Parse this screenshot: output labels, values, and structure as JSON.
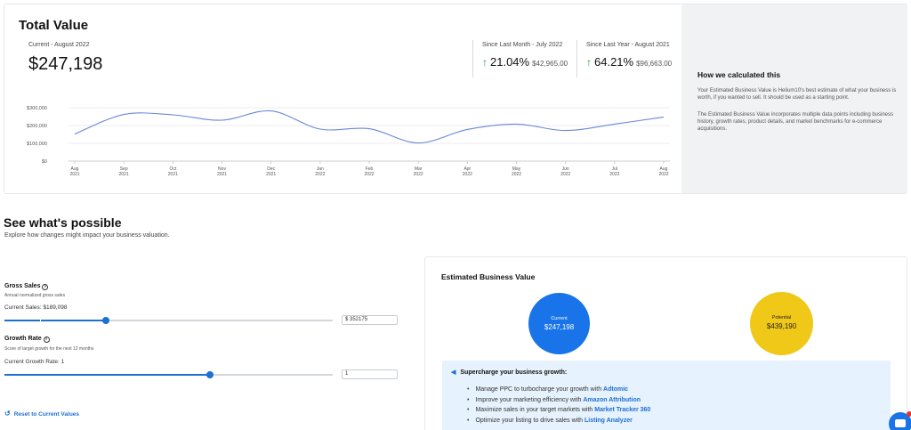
{
  "total_value": {
    "title": "Total Value",
    "current_label": "Current - August 2022",
    "current_value": "$247,198",
    "since_month": {
      "label": "Since Last Month - July 2022",
      "pct": "21.04%",
      "abs": "$42,965.00"
    },
    "since_year": {
      "label": "Since Last Year - August 2021",
      "pct": "64.21%",
      "abs": "$96,663.00"
    },
    "arrow_icon": "arrow-up-icon",
    "up_color": "#1aa34a"
  },
  "how_calculated": {
    "title": "How we calculated this",
    "p1": "Your Estimated Business Value is Helium10's best estimate of what your business is worth, if you wanted to sell. It should be used as a starting point.",
    "p2": "The Estimated Business Value incorporates multiple data points including business history, growth rates, product details, and market benchmarks for e-commerce acquisitions."
  },
  "chart_data": {
    "type": "line",
    "categories": [
      "Aug 2021",
      "Sep 2021",
      "Oct 2021",
      "Nov 2021",
      "Dec 2021",
      "Jan 2022",
      "Feb 2022",
      "Mar 2022",
      "Apr 2022",
      "May 2022",
      "Jun 2022",
      "Jul 2022",
      "Aug 2022"
    ],
    "x_tick_lines": [
      [
        "Aug",
        "2021"
      ],
      [
        "Sep",
        "2021"
      ],
      [
        "Oct",
        "2021"
      ],
      [
        "Nov",
        "2021"
      ],
      [
        "Dec",
        "2021"
      ],
      [
        "Jan",
        "2022"
      ],
      [
        "Feb",
        "2022"
      ],
      [
        "Mar",
        "2022"
      ],
      [
        "Apr",
        "2022"
      ],
      [
        "May",
        "2022"
      ],
      [
        "Jun",
        "2022"
      ],
      [
        "Jul",
        "2022"
      ],
      [
        "Aug",
        "2022"
      ]
    ],
    "series": [
      {
        "values": [
          152000,
          262000,
          260000,
          230000,
          282000,
          180000,
          182000,
          102000,
          178000,
          208000,
          172000,
          208000,
          248000
        ]
      }
    ],
    "y_ticks": [
      0,
      100000,
      200000,
      300000
    ],
    "y_tick_labels": [
      "$0",
      "$100,000",
      "$200,000",
      "$300,000"
    ],
    "ylim": [
      0,
      300000
    ],
    "grid": true,
    "line_color": "#6a86d8"
  },
  "possible": {
    "title": "See what's possible",
    "subtitle": "Explore how changes might impact your business valuation."
  },
  "gross_sales": {
    "label": "Gross Sales",
    "info_icon": "info-icon",
    "description": "Annual normalized gross sales",
    "current": "Current Sales: $189,098",
    "input_value": "$  352175",
    "slider_fraction": 0.31
  },
  "growth_rate": {
    "label": "Growth Rate",
    "info_icon": "info-icon",
    "description": "Score of target growth for the next 12 months",
    "current": "Current Growth Rate: 1",
    "input_value": "1",
    "slider_fraction": 0.625
  },
  "reset_label": "Reset to Current Values",
  "ebv": {
    "title": "Estimated Business Value",
    "current_label": "Current",
    "current_value": "$247,198",
    "potential_label": "Potential",
    "potential_value": "$439,190",
    "current_color": "#1874e8",
    "potential_color": "#f0c818"
  },
  "growth": {
    "title": "Supercharge your business growth:",
    "icon": "megaphone-icon",
    "items": [
      {
        "text": "Manage PPC to turbocharge your growth with ",
        "link": "Adtomic"
      },
      {
        "text": "Improve your marketing efficiency with ",
        "link": "Amazon Attribution"
      },
      {
        "text": "Maximize sales in your target markets with ",
        "link": "Market Tracker 360"
      },
      {
        "text": "Optimize your listing to drive sales with ",
        "link": "Listing Analyzer"
      }
    ]
  }
}
